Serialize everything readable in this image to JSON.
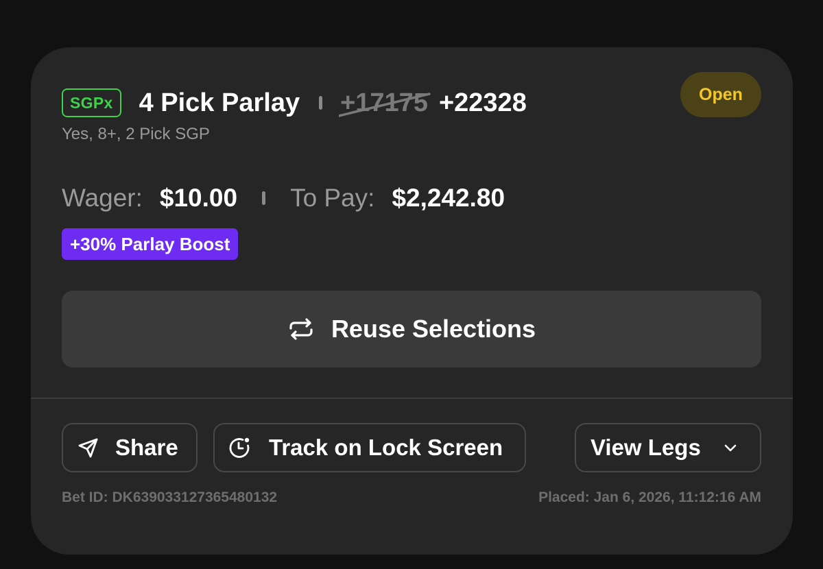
{
  "bet": {
    "type_badge": "SGPx",
    "title": "4 Pick Parlay",
    "original_odds": "+17175",
    "boosted_odds": "+22328",
    "subtitle": "Yes, 8+, 2 Pick SGP",
    "status": "Open",
    "wager_label": "Wager:",
    "wager_value": "$10.00",
    "payout_label": "To Pay:",
    "payout_value": "$2,242.80",
    "boost_label": "+30% Parlay Boost",
    "bet_id": "Bet ID: DK639033127365480132",
    "placed": "Placed: Jan 6, 2026, 11:12:16 AM"
  },
  "actions": {
    "reuse_label": "Reuse Selections",
    "share_label": "Share",
    "track_label": "Track on Lock Screen",
    "legs_label": "View Legs"
  },
  "colors": {
    "page_bg": "#111111",
    "card_bg": "#262626",
    "sgpx_green": "#3ed14a",
    "status_yellow": "#f3c62a",
    "status_bg": "#4c4217",
    "boost_purple": "#6e2bf2",
    "button_bg": "#3a3a3a"
  },
  "icons": {
    "reuse": "repeat-arrows-icon",
    "share": "paper-plane-icon",
    "track": "lock-screen-timer-icon",
    "legs": "chevron-down-icon"
  }
}
